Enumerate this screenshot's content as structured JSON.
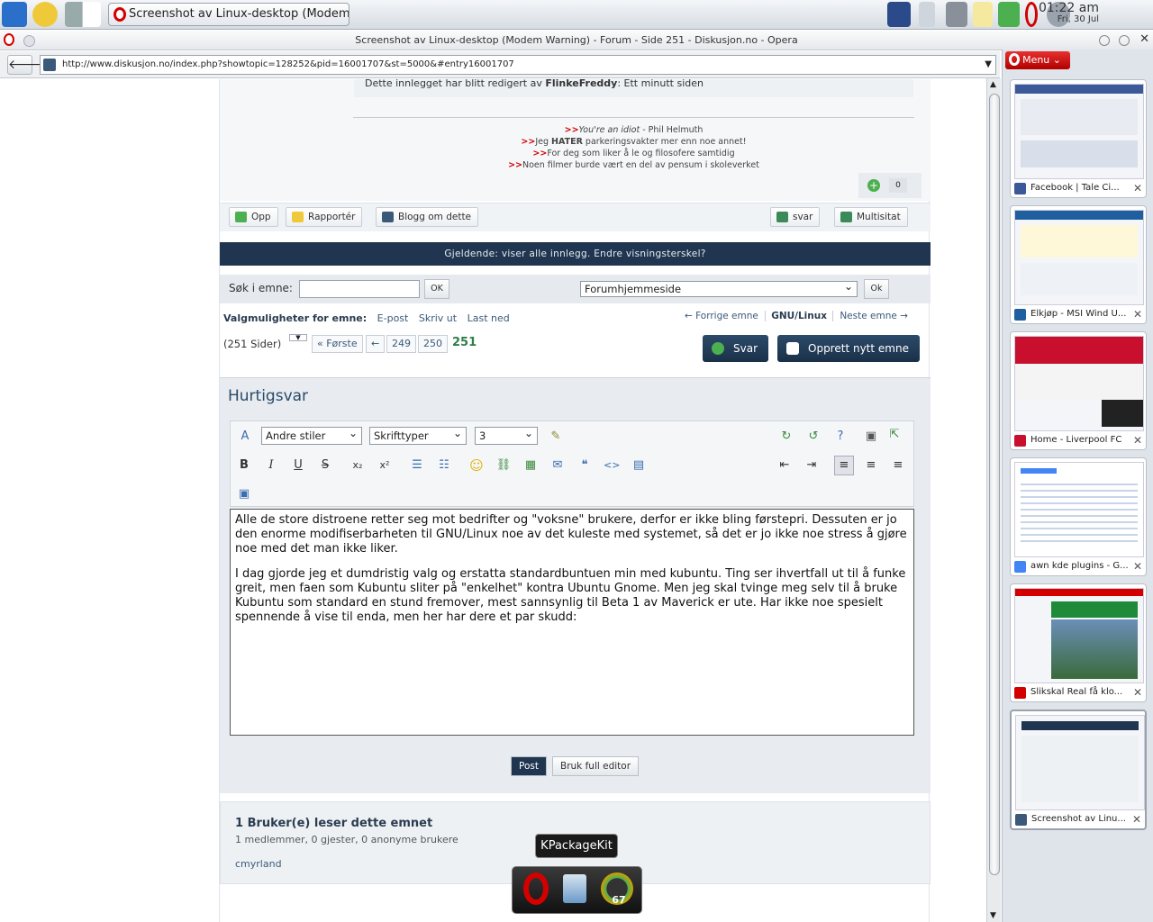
{
  "kde_panel": {
    "task_title": "Screenshot av Linux-desktop (Modem W",
    "clock_time": "01:22 am",
    "clock_date": "Fri, 30 Jul"
  },
  "opera": {
    "window_title": "Screenshot av Linux-desktop (Modem Warning) - Forum - Side 251 - Diskusjon.no - Opera",
    "url": "http://www.diskusjon.no/index.php?showtopic=128252&pid=16001707&st=5000&#entry16001707",
    "menu_label": "Menu"
  },
  "post": {
    "edited_by_prefix": "Dette innlegget har blitt redigert av ",
    "edited_by_user": "FlinkeFreddy",
    "edited_by_suffix": ": Ett minutt siden",
    "sig_marker": ">>",
    "sig1_italic": "You're an idiot",
    "sig1_rest": " - Phil Helmuth",
    "sig2_a": "Jeg ",
    "sig2_b": "HATER",
    "sig2_c": " parkeringsvakter mer enn noe annet!",
    "sig3": "For deg som liker å le og filosofere samtidig",
    "sig4": "Noen filmer burde vært en del av pensum i skoleverket",
    "rep_count": "0",
    "buttons": {
      "up": "Opp",
      "report": "Rapportér",
      "blog": "Blogg om dette",
      "reply": "svar",
      "multiquote": "Multisitat"
    }
  },
  "nav_strip": "Gjeldende: viser alle innlegg. Endre visningsterskel?",
  "search": {
    "label": "Søk i emne:",
    "ok": "OK",
    "jump_select": "Forumhjemmeside",
    "jump_ok": "Ok"
  },
  "options": {
    "label": "Valgmuligheter for emne:",
    "email": "E-post",
    "print": "Skriv ut",
    "download": "Last ned",
    "prev_topic": "← Forrige emne",
    "current_forum": "GNU/Linux",
    "next_topic": "Neste emne →"
  },
  "pagination": {
    "pages_label": "(251 Sider)",
    "first": "« Første",
    "prev_arrow": "←",
    "p1": "249",
    "p2": "250",
    "current": "251",
    "reply_button": "Svar",
    "new_topic_button": "Opprett nytt emne"
  },
  "quick_reply": {
    "title": "Hurtigsvar",
    "style_select": "Andre stiler",
    "font_select": "Skrifttyper",
    "size_select": "3",
    "paragraph1": "Alle de store distroene retter seg mot bedrifter og \"voksne\" brukere, derfor er ikke bling førstepri. Dessuten er jo den enorme modifiserbarheten til GNU/Linux noe av det kuleste med systemet, så det er jo ikke noe stress å gjøre noe med det man ikke liker.",
    "paragraph2": "I dag gjorde jeg et dumdristig valg og erstatta standardbuntuen min med kubuntu. Ting ser ihvertfall ut til å funke greit, men faen som Kubuntu sliter på \"enkelhet\" kontra Ubuntu Gnome. Men jeg skal tvinge meg selv til å bruke Kubuntu som standard en stund fremover, mest sannsynlig til Beta 1 av Maverick er ute. Har ikke noe spesielt spennende å vise til enda, men her har dere et par skudd:",
    "post_button": "Post",
    "full_editor_button": "Bruk full editor"
  },
  "readers": {
    "title": "1 Bruker(e) leser dette emnet",
    "summary": "1 medlemmer, 0 gjester, 0 anonyme brukere",
    "user": "cmyrland"
  },
  "tabs": [
    {
      "title": "Facebook | Tale Ci...",
      "color": "#3b5998"
    },
    {
      "title": "Elkjøp - MSI Wind U...",
      "color": "#1f5fa0"
    },
    {
      "title": "Home - Liverpool FC",
      "color": "#c8102e"
    },
    {
      "title": "awn kde plugins - G...",
      "color": "#4285f4"
    },
    {
      "title": "Slikskal Real få klo...",
      "color": "#d40000"
    },
    {
      "title": "Screenshot av Linu...",
      "color": "#3b5a7a"
    }
  ],
  "dock": {
    "tooltip": "KPackageKit",
    "badge": "67"
  }
}
